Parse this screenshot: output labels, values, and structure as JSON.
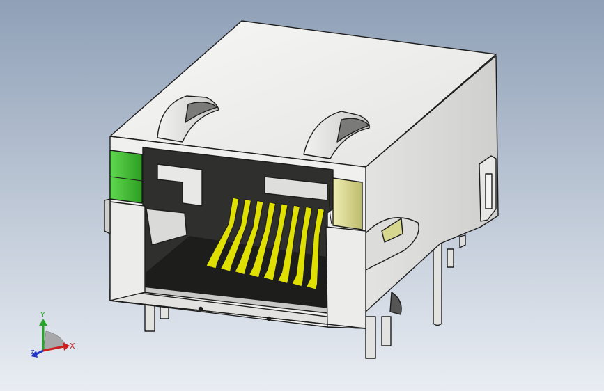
{
  "viewport": {
    "background_top": "#8fa0b7",
    "background_bottom": "#e9edf3"
  },
  "model": {
    "body_color": "#f0f0ef",
    "body_shade": "#d6d6d4",
    "body_dark": "#b9b9b7",
    "cavity_color": "#2f302e",
    "pin_color": "#e0e000",
    "led_left_color": "#3dbd2f",
    "led_right_color": "#d9d78e",
    "pin_count": 8
  },
  "triad": {
    "x_label": "X",
    "y_label": "Y",
    "z_label": "Z",
    "x_color": "#cc1f1f",
    "y_color": "#27a52a",
    "z_color": "#2233c8"
  }
}
